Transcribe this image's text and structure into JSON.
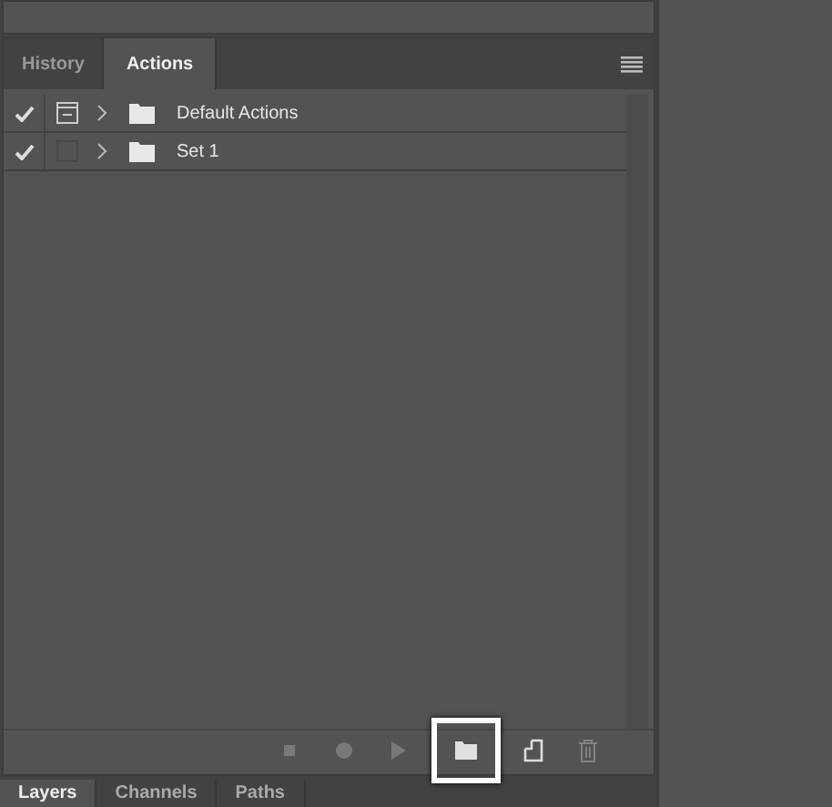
{
  "panel": {
    "tabs": [
      {
        "label": "History",
        "selected": false
      },
      {
        "label": "Actions",
        "selected": true
      }
    ],
    "rows": [
      {
        "name": "Default Actions",
        "checked": true,
        "dialog_on": true,
        "expanded": false
      },
      {
        "name": "Set 1",
        "checked": true,
        "dialog_on": false,
        "expanded": false
      }
    ],
    "toolbar": [
      {
        "kind": "stop",
        "disabled": true,
        "highlighted": false
      },
      {
        "kind": "record",
        "disabled": true,
        "highlighted": false
      },
      {
        "kind": "play",
        "disabled": true,
        "highlighted": false
      },
      {
        "kind": "folder",
        "disabled": false,
        "highlighted": true
      },
      {
        "kind": "new",
        "disabled": false,
        "highlighted": false
      },
      {
        "kind": "trash",
        "disabled": true,
        "highlighted": false
      }
    ]
  },
  "bottom_tabs": [
    {
      "label": "Layers",
      "selected": true
    },
    {
      "label": "Channels",
      "selected": false
    },
    {
      "label": "Paths",
      "selected": false
    }
  ]
}
